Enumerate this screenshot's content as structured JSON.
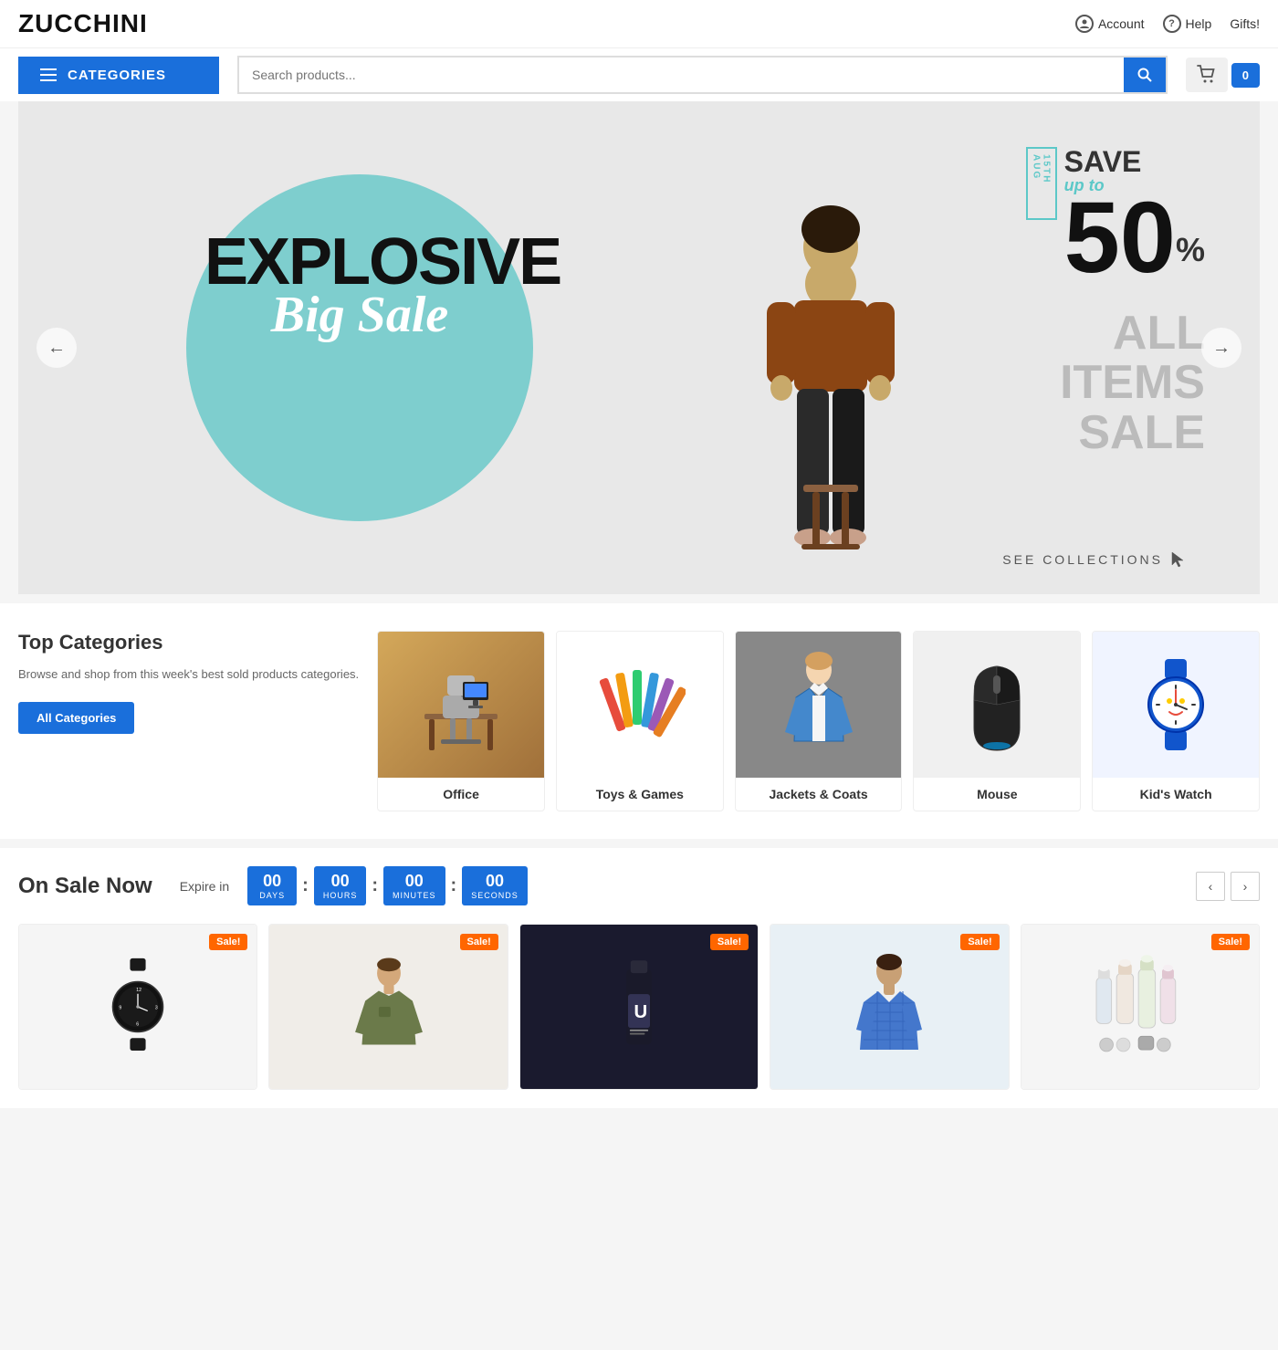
{
  "header": {
    "logo": "ZUCCHINI",
    "nav": {
      "account_label": "Account",
      "help_label": "Help",
      "gifts_label": "Gifts!"
    }
  },
  "toolbar": {
    "categories_label": "CATEGORIES",
    "search_placeholder": "Search products...",
    "cart_count": "0"
  },
  "hero": {
    "tag_line1": "EXPLOSIVE",
    "tag_line2": "Big Sale",
    "date_badge": "15TH AUG",
    "save_text": "SAVE",
    "upto_text": "up to",
    "percent": "50",
    "percent_sign": "%",
    "all_items_line1": "ALL",
    "all_items_line2": "ITEMS",
    "all_items_line3": "SALE",
    "see_collections": "SEE COLLECTIONS",
    "prev_btn": "←",
    "next_btn": "→"
  },
  "top_categories": {
    "heading": "Top Categories",
    "description": "Browse and shop from this week's best sold products categories.",
    "all_btn_label": "All Categories",
    "items": [
      {
        "id": "office",
        "label": "Office"
      },
      {
        "id": "toys",
        "label": "Toys & Games"
      },
      {
        "id": "jackets",
        "label": "Jackets & Coats"
      },
      {
        "id": "mouse",
        "label": "Mouse"
      },
      {
        "id": "watch",
        "label": "Kid's Watch"
      }
    ]
  },
  "on_sale": {
    "title": "On Sale Now",
    "expire_label": "Expire in",
    "countdown": {
      "days": "00",
      "hours": "00",
      "minutes": "00",
      "seconds": "00",
      "days_label": "DAYS",
      "hours_label": "HOURS",
      "minutes_label": "MINUTES",
      "seconds_label": "SECONDS"
    },
    "products": [
      {
        "id": "watch",
        "badge": "Sale!"
      },
      {
        "id": "tshirt",
        "badge": "Sale!"
      },
      {
        "id": "package",
        "badge": "Sale!"
      },
      {
        "id": "blue-shirt",
        "badge": "Sale!"
      },
      {
        "id": "bottles",
        "badge": "Sale!"
      }
    ]
  }
}
